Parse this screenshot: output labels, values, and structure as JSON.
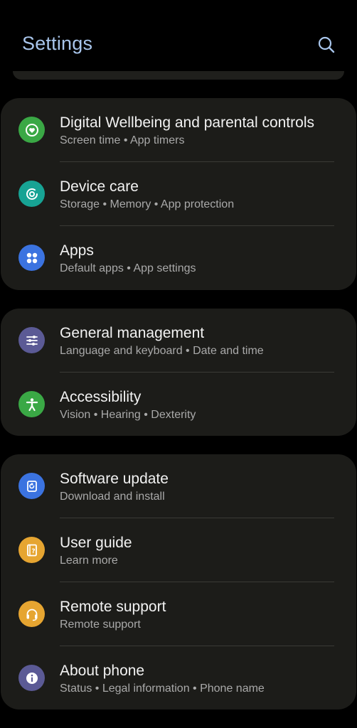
{
  "header": {
    "title": "Settings"
  },
  "colors": {
    "title": "#a9c6ec",
    "card_background": "#1c1c19",
    "digital_wellbeing": "#3aa845",
    "device_care": "#17a394",
    "apps": "#3b73e0",
    "general_management": "#5b5a95",
    "accessibility": "#3aa845",
    "software_update": "#3b73e0",
    "user_guide": "#e6a531",
    "remote_support": "#e6a531",
    "about_phone": "#5b5a95"
  },
  "groups": [
    {
      "items": [
        {
          "label": "Digital Wellbeing and parental controls",
          "sub": "Screen time  •  App timers",
          "icon": "digital-wellbeing-icon"
        },
        {
          "label": "Device care",
          "sub": "Storage  •  Memory  •  App protection",
          "icon": "device-care-icon"
        },
        {
          "label": "Apps",
          "sub": "Default apps  •  App settings",
          "icon": "apps-icon"
        }
      ]
    },
    {
      "items": [
        {
          "label": "General management",
          "sub": "Language and keyboard  •  Date and time",
          "icon": "sliders-icon"
        },
        {
          "label": "Accessibility",
          "sub": "Vision  •  Hearing  •  Dexterity",
          "icon": "accessibility-icon"
        }
      ]
    },
    {
      "items": [
        {
          "label": "Software update",
          "sub": "Download and install",
          "icon": "software-update-icon"
        },
        {
          "label": "User guide",
          "sub": "Learn more",
          "icon": "user-guide-icon"
        },
        {
          "label": "Remote support",
          "sub": "Remote support",
          "icon": "headset-icon"
        },
        {
          "label": "About phone",
          "sub": "Status  •  Legal information  •  Phone name",
          "icon": "info-icon"
        }
      ]
    }
  ]
}
